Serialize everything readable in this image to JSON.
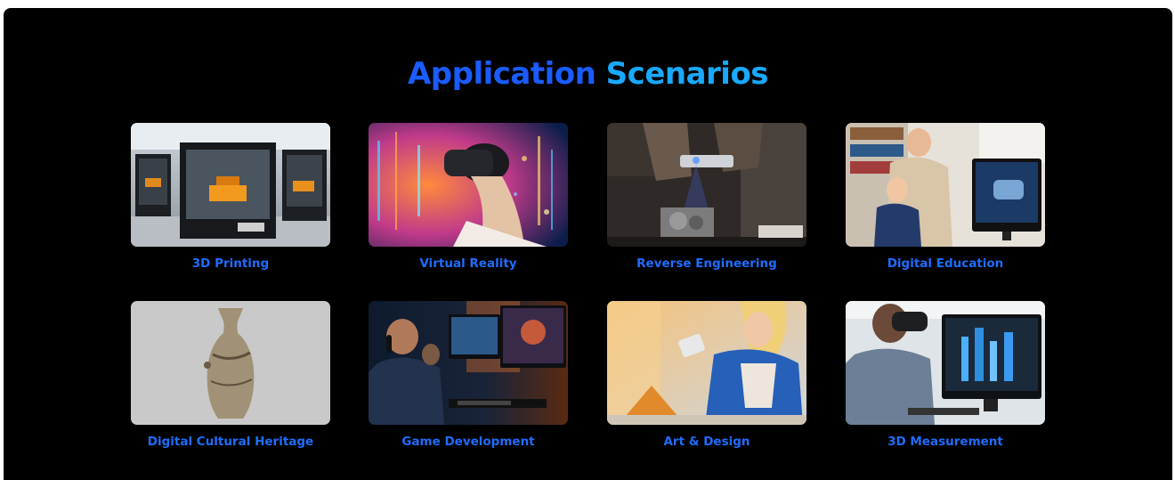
{
  "section": {
    "title_part1": "Application",
    "title_part2": "Scenarios"
  },
  "colors": {
    "background": "#000000",
    "title_primary": "#1a5cff",
    "title_secondary": "#19a9ff",
    "caption": "#1f6dff"
  },
  "scenarios": [
    {
      "label": "3D Printing",
      "image": "3d-printers-image"
    },
    {
      "label": "Virtual Reality",
      "image": "vr-headset-image"
    },
    {
      "label": "Reverse Engineering",
      "image": "handheld-scanner-image"
    },
    {
      "label": "Digital Education",
      "image": "teacher-student-monitor-image"
    },
    {
      "label": "Digital Cultural Heritage",
      "image": "ancient-vase-image"
    },
    {
      "label": "Game Development",
      "image": "game-developers-image"
    },
    {
      "label": "Art & Design",
      "image": "artist-scanning-image"
    },
    {
      "label": "3D Measurement",
      "image": "vr-engineer-cad-image"
    }
  ]
}
